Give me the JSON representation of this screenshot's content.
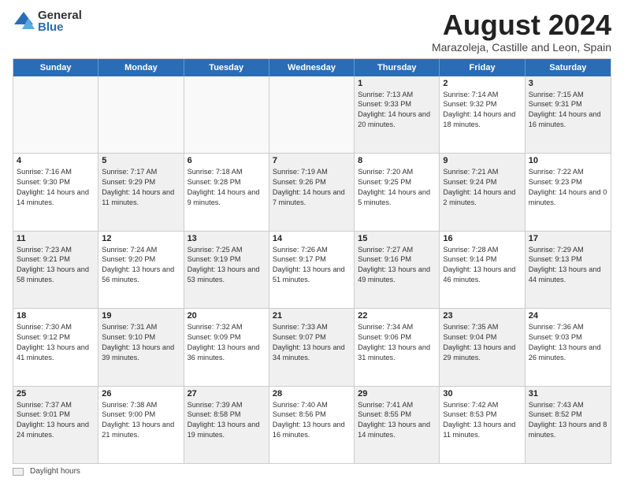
{
  "logo": {
    "general": "General",
    "blue": "Blue"
  },
  "title": "August 2024",
  "subtitle": "Marazoleja, Castille and Leon, Spain",
  "header_days": [
    "Sunday",
    "Monday",
    "Tuesday",
    "Wednesday",
    "Thursday",
    "Friday",
    "Saturday"
  ],
  "weeks": [
    [
      {
        "day": "",
        "text": "",
        "empty": true
      },
      {
        "day": "",
        "text": "",
        "empty": true
      },
      {
        "day": "",
        "text": "",
        "empty": true
      },
      {
        "day": "",
        "text": "",
        "empty": true
      },
      {
        "day": "1",
        "text": "Sunrise: 7:13 AM\nSunset: 9:33 PM\nDaylight: 14 hours and 20 minutes.",
        "shaded": true
      },
      {
        "day": "2",
        "text": "Sunrise: 7:14 AM\nSunset: 9:32 PM\nDaylight: 14 hours and 18 minutes.",
        "shaded": false
      },
      {
        "day": "3",
        "text": "Sunrise: 7:15 AM\nSunset: 9:31 PM\nDaylight: 14 hours and 16 minutes.",
        "shaded": true
      }
    ],
    [
      {
        "day": "4",
        "text": "Sunrise: 7:16 AM\nSunset: 9:30 PM\nDaylight: 14 hours and 14 minutes.",
        "shaded": false
      },
      {
        "day": "5",
        "text": "Sunrise: 7:17 AM\nSunset: 9:29 PM\nDaylight: 14 hours and 11 minutes.",
        "shaded": true
      },
      {
        "day": "6",
        "text": "Sunrise: 7:18 AM\nSunset: 9:28 PM\nDaylight: 14 hours and 9 minutes.",
        "shaded": false
      },
      {
        "day": "7",
        "text": "Sunrise: 7:19 AM\nSunset: 9:26 PM\nDaylight: 14 hours and 7 minutes.",
        "shaded": true
      },
      {
        "day": "8",
        "text": "Sunrise: 7:20 AM\nSunset: 9:25 PM\nDaylight: 14 hours and 5 minutes.",
        "shaded": false
      },
      {
        "day": "9",
        "text": "Sunrise: 7:21 AM\nSunset: 9:24 PM\nDaylight: 14 hours and 2 minutes.",
        "shaded": true
      },
      {
        "day": "10",
        "text": "Sunrise: 7:22 AM\nSunset: 9:23 PM\nDaylight: 14 hours and 0 minutes.",
        "shaded": false
      }
    ],
    [
      {
        "day": "11",
        "text": "Sunrise: 7:23 AM\nSunset: 9:21 PM\nDaylight: 13 hours and 58 minutes.",
        "shaded": true
      },
      {
        "day": "12",
        "text": "Sunrise: 7:24 AM\nSunset: 9:20 PM\nDaylight: 13 hours and 56 minutes.",
        "shaded": false
      },
      {
        "day": "13",
        "text": "Sunrise: 7:25 AM\nSunset: 9:19 PM\nDaylight: 13 hours and 53 minutes.",
        "shaded": true
      },
      {
        "day": "14",
        "text": "Sunrise: 7:26 AM\nSunset: 9:17 PM\nDaylight: 13 hours and 51 minutes.",
        "shaded": false
      },
      {
        "day": "15",
        "text": "Sunrise: 7:27 AM\nSunset: 9:16 PM\nDaylight: 13 hours and 49 minutes.",
        "shaded": true
      },
      {
        "day": "16",
        "text": "Sunrise: 7:28 AM\nSunset: 9:14 PM\nDaylight: 13 hours and 46 minutes.",
        "shaded": false
      },
      {
        "day": "17",
        "text": "Sunrise: 7:29 AM\nSunset: 9:13 PM\nDaylight: 13 hours and 44 minutes.",
        "shaded": true
      }
    ],
    [
      {
        "day": "18",
        "text": "Sunrise: 7:30 AM\nSunset: 9:12 PM\nDaylight: 13 hours and 41 minutes.",
        "shaded": false
      },
      {
        "day": "19",
        "text": "Sunrise: 7:31 AM\nSunset: 9:10 PM\nDaylight: 13 hours and 39 minutes.",
        "shaded": true
      },
      {
        "day": "20",
        "text": "Sunrise: 7:32 AM\nSunset: 9:09 PM\nDaylight: 13 hours and 36 minutes.",
        "shaded": false
      },
      {
        "day": "21",
        "text": "Sunrise: 7:33 AM\nSunset: 9:07 PM\nDaylight: 13 hours and 34 minutes.",
        "shaded": true
      },
      {
        "day": "22",
        "text": "Sunrise: 7:34 AM\nSunset: 9:06 PM\nDaylight: 13 hours and 31 minutes.",
        "shaded": false
      },
      {
        "day": "23",
        "text": "Sunrise: 7:35 AM\nSunset: 9:04 PM\nDaylight: 13 hours and 29 minutes.",
        "shaded": true
      },
      {
        "day": "24",
        "text": "Sunrise: 7:36 AM\nSunset: 9:03 PM\nDaylight: 13 hours and 26 minutes.",
        "shaded": false
      }
    ],
    [
      {
        "day": "25",
        "text": "Sunrise: 7:37 AM\nSunset: 9:01 PM\nDaylight: 13 hours and 24 minutes.",
        "shaded": true
      },
      {
        "day": "26",
        "text": "Sunrise: 7:38 AM\nSunset: 9:00 PM\nDaylight: 13 hours and 21 minutes.",
        "shaded": false
      },
      {
        "day": "27",
        "text": "Sunrise: 7:39 AM\nSunset: 8:58 PM\nDaylight: 13 hours and 19 minutes.",
        "shaded": true
      },
      {
        "day": "28",
        "text": "Sunrise: 7:40 AM\nSunset: 8:56 PM\nDaylight: 13 hours and 16 minutes.",
        "shaded": false
      },
      {
        "day": "29",
        "text": "Sunrise: 7:41 AM\nSunset: 8:55 PM\nDaylight: 13 hours and 14 minutes.",
        "shaded": true
      },
      {
        "day": "30",
        "text": "Sunrise: 7:42 AM\nSunset: 8:53 PM\nDaylight: 13 hours and 11 minutes.",
        "shaded": false
      },
      {
        "day": "31",
        "text": "Sunrise: 7:43 AM\nSunset: 8:52 PM\nDaylight: 13 hours and 8 minutes.",
        "shaded": true
      }
    ]
  ],
  "footer": {
    "legend_label": "Daylight hours"
  }
}
